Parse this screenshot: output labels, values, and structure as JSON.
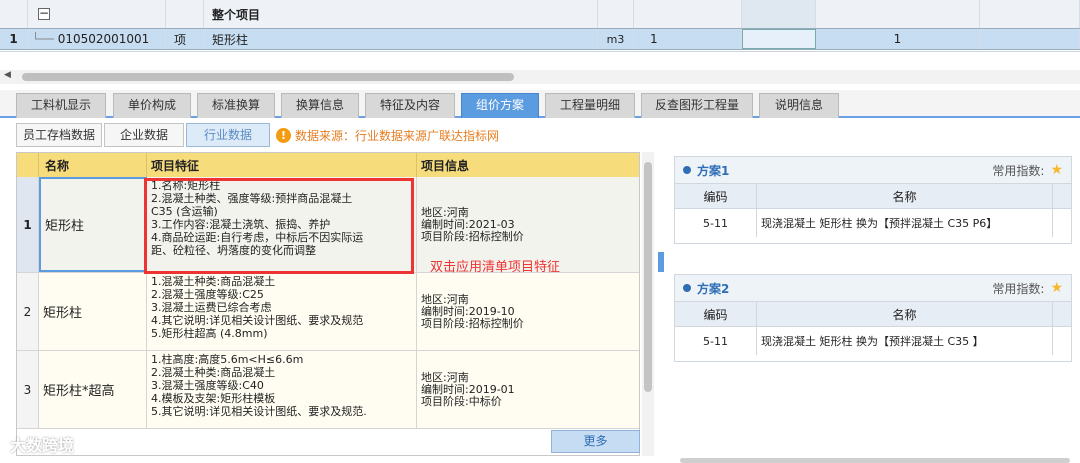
{
  "top_grid": {
    "header": {
      "name": "整个项目"
    },
    "row": {
      "num": "1",
      "code": "010502001001",
      "type": "项",
      "name": "矩形柱",
      "unit": "m3",
      "qty": "1",
      "value": "1"
    }
  },
  "tabs": [
    "工料机显示",
    "单价构成",
    "标准换算",
    "换算信息",
    "特征及内容",
    "组价方案",
    "工程量明细",
    "反查图形工程量",
    "说明信息"
  ],
  "active_tab": "组价方案",
  "subtabs": [
    "员工存档数据",
    "企业数据",
    "行业数据"
  ],
  "notice": "数据来源：行业数据来源广联达指标网",
  "left_table": {
    "headers": {
      "name": "名称",
      "feature": "项目特征",
      "info": "项目信息"
    },
    "rows": [
      {
        "num": "1",
        "name": "矩形柱",
        "features": [
          "1.名称:矩形柱",
          "2.混凝土种类、强度等级:预拌商品混凝土",
          "C35 (含运输)",
          "3.工作内容:混凝土浇筑、振捣、养护",
          "4.商品砼运距:自行考虑，中标后不因实际运",
          "距、砼粒径、坍落度的变化而调整"
        ],
        "info": [
          "地区:河南",
          "编制时间:2021-03",
          "项目阶段:招标控制价"
        ]
      },
      {
        "num": "2",
        "name": "矩形柱",
        "features": [
          "1.混凝土种类:商品混凝土",
          "2.混凝土强度等级:C25",
          "3.混凝土运费已综合考虑",
          "4.其它说明:详见相关设计图纸、要求及规范",
          "5.矩形柱超高 (4.8mm)"
        ],
        "info": [
          "地区:河南",
          "编制时间:2019-10",
          "项目阶段:招标控制价"
        ]
      },
      {
        "num": "3",
        "name": "矩形柱*超高",
        "features": [
          "1.柱高度:高度5.6m<H≤6.6m",
          "2.混凝土种类:商品混凝土",
          "3.混凝土强度等级:C40",
          "4.模板及支架:矩形柱模板",
          "5.其它说明:详见相关设计图纸、要求及规范."
        ],
        "info": [
          "地区:河南",
          "编制时间:2019-01",
          "项目阶段:中标价"
        ]
      }
    ]
  },
  "hint_text": "双击应用清单项目特征",
  "more_label": "更多",
  "watermark": "大数跨境",
  "plans": [
    {
      "title": "方案1",
      "freq_label": "常用指数:",
      "col_code": "编码",
      "col_name": "名称",
      "code": "5-11",
      "name": "现浇混凝土 矩形柱  换为【预拌混凝土 C35 P6】"
    },
    {
      "title": "方案2",
      "freq_label": "常用指数:",
      "col_code": "编码",
      "col_name": "名称",
      "code": "5-11",
      "name": "现浇混凝土 矩形柱  换为【预拌混凝土 C35 】"
    }
  ]
}
